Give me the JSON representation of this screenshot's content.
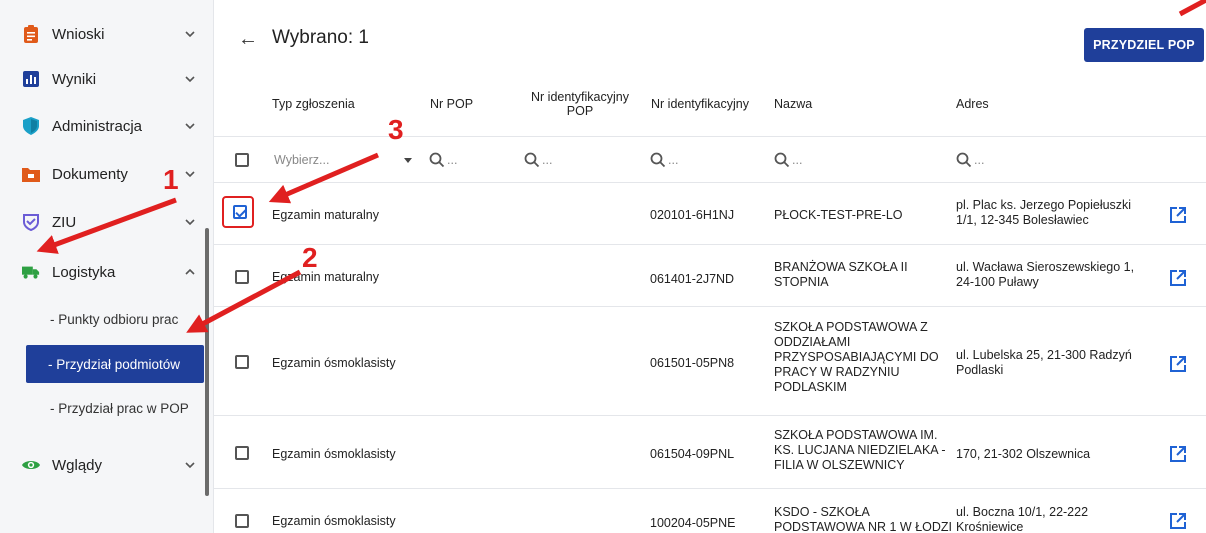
{
  "sidebar": {
    "items": [
      {
        "label": "Wnioski",
        "icon": "clipboard-icon",
        "color": "#e05a1a",
        "expanded": false
      },
      {
        "label": "Wyniki",
        "icon": "bar-chart-icon",
        "color": "#1f3f9a",
        "expanded": false
      },
      {
        "label": "Administracja",
        "icon": "shield-icon",
        "color": "#1aa0c8",
        "expanded": false
      },
      {
        "label": "Dokumenty",
        "icon": "folder-icon",
        "color": "#e05a1a",
        "expanded": false
      },
      {
        "label": "ZIU",
        "icon": "check-shield-icon",
        "color": "#6b5cd6",
        "expanded": false
      },
      {
        "label": "Logistyka",
        "icon": "truck-icon",
        "color": "#2ea043",
        "expanded": true
      },
      {
        "label": "Wglądy",
        "icon": "eye-icon",
        "color": "#2ea043",
        "expanded": false
      }
    ],
    "subitems": [
      {
        "label": "- Punkty odbioru prac",
        "active": false
      },
      {
        "label": "- Przydział podmiotów",
        "active": true
      },
      {
        "label": "- Przydział prac w POP",
        "active": false
      }
    ]
  },
  "header": {
    "title": "Wybrano: 1",
    "primary_button": "PRZYDZIEL POP"
  },
  "table": {
    "columns": [
      "Typ zgłoszenia",
      "Nr POP",
      "Nr identyfikacyjny POP",
      "Nr identyfikacyjny",
      "Nazwa",
      "Adres"
    ],
    "filter_placeholder": "Wybierz...",
    "search_placeholder": "...",
    "rows": [
      {
        "checked": true,
        "type": "Egzamin maturalny",
        "nr_pop": "",
        "nr_id_pop": "",
        "nr_id": "020101-6H1NJ",
        "name": "PŁOCK-TEST-PRE-LO",
        "address": "pl. Plac ks. Jerzego Popiełuszki 1/1, 12-345 Bolesławiec"
      },
      {
        "checked": false,
        "type": "Egzamin maturalny",
        "nr_pop": "",
        "nr_id_pop": "",
        "nr_id": "061401-2J7ND",
        "name": "BRANŻOWA SZKOŁA II STOPNIA",
        "address": "ul. Wacława Sieroszewskiego 1, 24-100 Puławy"
      },
      {
        "checked": false,
        "type": "Egzamin ósmoklasisty",
        "nr_pop": "",
        "nr_id_pop": "",
        "nr_id": "061501-05PN8",
        "name": "SZKOŁA PODSTAWOWA Z ODDZIAŁAMI PRZYSPOSABIAJĄCYMI DO PRACY W RADZYNIU PODLASKIM",
        "address": "ul. Lubelska 25, 21-300 Radzyń Podlaski"
      },
      {
        "checked": false,
        "type": "Egzamin ósmoklasisty",
        "nr_pop": "",
        "nr_id_pop": "",
        "nr_id": "061504-09PNL",
        "name": "SZKOŁA PODSTAWOWA IM. KS. LUCJANA NIEDZIELAKA - FILIA W OLSZEWNICY",
        "address": "170, 21-302 Olszewnica"
      },
      {
        "checked": false,
        "type": "Egzamin ósmoklasisty",
        "nr_pop": "",
        "nr_id_pop": "",
        "nr_id": "100204-05PNE",
        "name": "KSDO - SZKOŁA PODSTAWOWA NR 1 W ŁODZI",
        "address": "ul. Boczna 10/1, 22-222 Krośniewice"
      }
    ]
  },
  "annotations": {
    "one": "1",
    "two": "2",
    "three": "3",
    "color": "#e02020"
  },
  "colors": {
    "accent": "#1f3f9a",
    "link_icon": "#1f62d4"
  }
}
